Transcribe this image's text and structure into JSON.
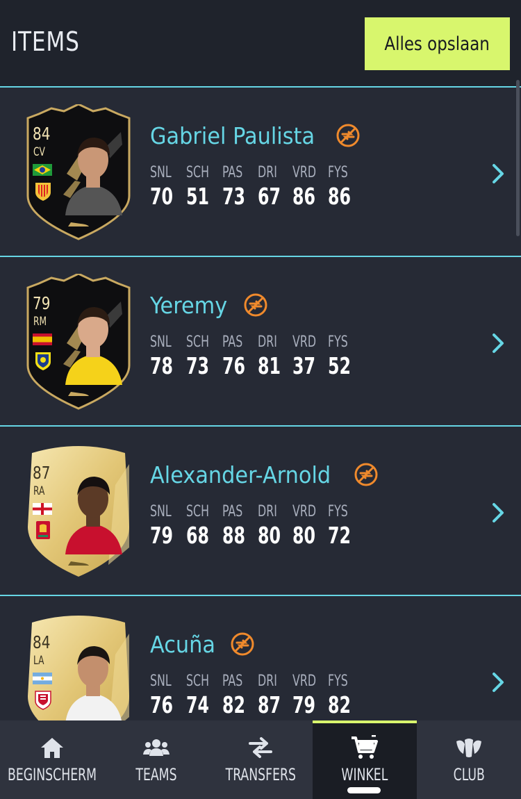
{
  "header": {
    "title": "ITEMS",
    "save_label": "Alles opslaan"
  },
  "stat_labels": [
    "SNL",
    "SCH",
    "PAS",
    "DRI",
    "VRD",
    "FYS"
  ],
  "players": [
    {
      "name": "Gabriel Paulista",
      "rating": "84",
      "position": "CV",
      "card": "totw",
      "flag": "brazil",
      "club": "valencia",
      "stats": [
        "70",
        "51",
        "73",
        "67",
        "86",
        "86"
      ]
    },
    {
      "name": "Yeremy",
      "rating": "79",
      "position": "RM",
      "card": "totw",
      "flag": "spain",
      "club": "villarreal",
      "stats": [
        "78",
        "73",
        "76",
        "81",
        "37",
        "52"
      ]
    },
    {
      "name": "Alexander-Arnold",
      "rating": "87",
      "position": "RA",
      "card": "gold",
      "flag": "england",
      "club": "liverpool",
      "stats": [
        "79",
        "68",
        "88",
        "80",
        "80",
        "72"
      ]
    },
    {
      "name": "Acuña",
      "rating": "84",
      "position": "LA",
      "card": "gold",
      "flag": "argentina",
      "club": "sevilla",
      "stats": [
        "76",
        "74",
        "82",
        "87",
        "79",
        "82"
      ]
    }
  ],
  "nav": [
    {
      "label": "BEGINSCHERM",
      "icon": "home-icon"
    },
    {
      "label": "TEAMS",
      "icon": "people-icon"
    },
    {
      "label": "TRANSFERS",
      "icon": "swap-arrows-icon"
    },
    {
      "label": "WINKEL",
      "icon": "cart-icon",
      "active": true
    },
    {
      "label": "CLUB",
      "icon": "club-icon"
    }
  ],
  "colors": {
    "accent": "#66d6e5",
    "button": "#d8f66d",
    "untradeable": "#f08a2c",
    "background": "#262a35"
  }
}
